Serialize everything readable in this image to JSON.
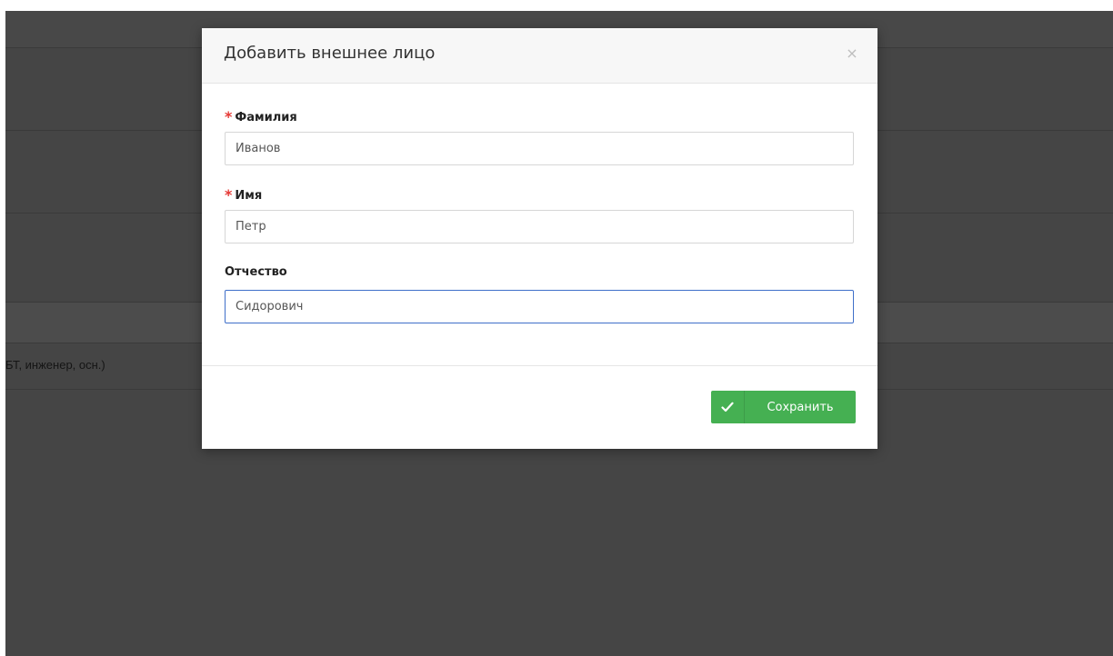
{
  "background": {
    "row_text": "БТ, инженер, осн.)"
  },
  "modal": {
    "title": "Добавить внешнее лицо",
    "close_glyph": "×",
    "fields": [
      {
        "label": "Фамилия",
        "required": true,
        "value": "Иванов"
      },
      {
        "label": "Имя",
        "required": true,
        "value": "Петр"
      },
      {
        "label": "Отчество",
        "required": false,
        "value": "Сидорович"
      }
    ],
    "required_marker": "*",
    "save_label": "Сохранить",
    "save_icon": "check-icon"
  },
  "colors": {
    "overlay": "#454545",
    "save_button": "#45b052",
    "required_marker": "#e53935",
    "focus_border": "#3f6fc9"
  }
}
